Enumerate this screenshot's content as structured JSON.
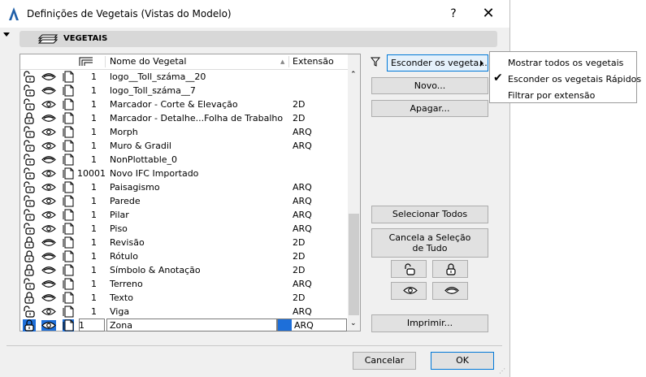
{
  "window": {
    "title": "Definições de Vegetais (Vistas do Modelo)",
    "help": "?",
    "close": "✕"
  },
  "section": {
    "title": "VEGETAIS"
  },
  "list": {
    "headers": {
      "name": "Nome do Vegetal",
      "ext": "Extensão"
    },
    "rows": [
      {
        "lock": "unlocked",
        "eye": "hidden",
        "pen": "1",
        "name": "logo__Toll_száma__20",
        "ext": ""
      },
      {
        "lock": "unlocked",
        "eye": "hidden",
        "pen": "1",
        "name": "logo_Toll_száma__7",
        "ext": ""
      },
      {
        "lock": "unlocked",
        "eye": "visible",
        "pen": "1",
        "name": "Marcador - Corte & Elevação",
        "ext": "2D"
      },
      {
        "lock": "locked",
        "eye": "hidden",
        "pen": "1",
        "name": "Marcador - Detalhe...Folha de Trabalho",
        "ext": "2D"
      },
      {
        "lock": "unlocked",
        "eye": "visible",
        "pen": "1",
        "name": "Morph",
        "ext": "ARQ"
      },
      {
        "lock": "unlocked",
        "eye": "visible",
        "pen": "1",
        "name": "Muro & Gradil",
        "ext": "ARQ"
      },
      {
        "lock": "unlocked",
        "eye": "hidden",
        "pen": "1",
        "name": "NonPlottable_0",
        "ext": ""
      },
      {
        "lock": "unlocked",
        "eye": "visible",
        "pen": "10001",
        "name": "Novo IFC Importado",
        "ext": ""
      },
      {
        "lock": "unlocked",
        "eye": "visible",
        "pen": "1",
        "name": "Paisagismo",
        "ext": "ARQ"
      },
      {
        "lock": "unlocked",
        "eye": "visible",
        "pen": "1",
        "name": "Parede",
        "ext": "ARQ"
      },
      {
        "lock": "unlocked",
        "eye": "visible",
        "pen": "1",
        "name": "Pilar",
        "ext": "ARQ"
      },
      {
        "lock": "unlocked",
        "eye": "visible",
        "pen": "1",
        "name": "Piso",
        "ext": "ARQ"
      },
      {
        "lock": "locked",
        "eye": "hidden",
        "pen": "1",
        "name": "Revisão",
        "ext": "2D"
      },
      {
        "lock": "locked",
        "eye": "hidden",
        "pen": "1",
        "name": "Rótulo",
        "ext": "2D"
      },
      {
        "lock": "locked",
        "eye": "hidden",
        "pen": "1",
        "name": "Símbolo & Anotação",
        "ext": "2D"
      },
      {
        "lock": "unlocked",
        "eye": "hidden",
        "pen": "1",
        "name": "Terreno",
        "ext": "ARQ"
      },
      {
        "lock": "locked",
        "eye": "hidden",
        "pen": "1",
        "name": "Texto",
        "ext": "2D"
      },
      {
        "lock": "unlocked",
        "eye": "visible",
        "pen": "1",
        "name": "Viga",
        "ext": "ARQ"
      },
      {
        "lock": "locked",
        "eye": "visible",
        "pen": "1",
        "name": "Zona",
        "ext": "ARQ",
        "selected": true
      }
    ]
  },
  "buttons": {
    "hide": "Esconder os vegeta...",
    "new": "Novo...",
    "delete": "Apagar...",
    "select_all": "Selecionar Todos",
    "deselect_line1": "Cancela a Seleção",
    "deselect_line2": "de Tudo",
    "print": "Imprimir...",
    "cancel": "Cancelar",
    "ok": "OK"
  },
  "popup": {
    "items": [
      {
        "label": "Mostrar todos os vegetais",
        "checked": false
      },
      {
        "label": "Esconder os vegetais Rápidos",
        "checked": true
      },
      {
        "label": "Filtrar por extensão",
        "checked": false
      }
    ]
  },
  "colors": {
    "accent": "#0078d7",
    "selection": "#1e6fd9"
  },
  "icons": {
    "lock_states": [
      "unlocked",
      "locked"
    ],
    "eye_states": [
      "visible",
      "hidden"
    ]
  }
}
